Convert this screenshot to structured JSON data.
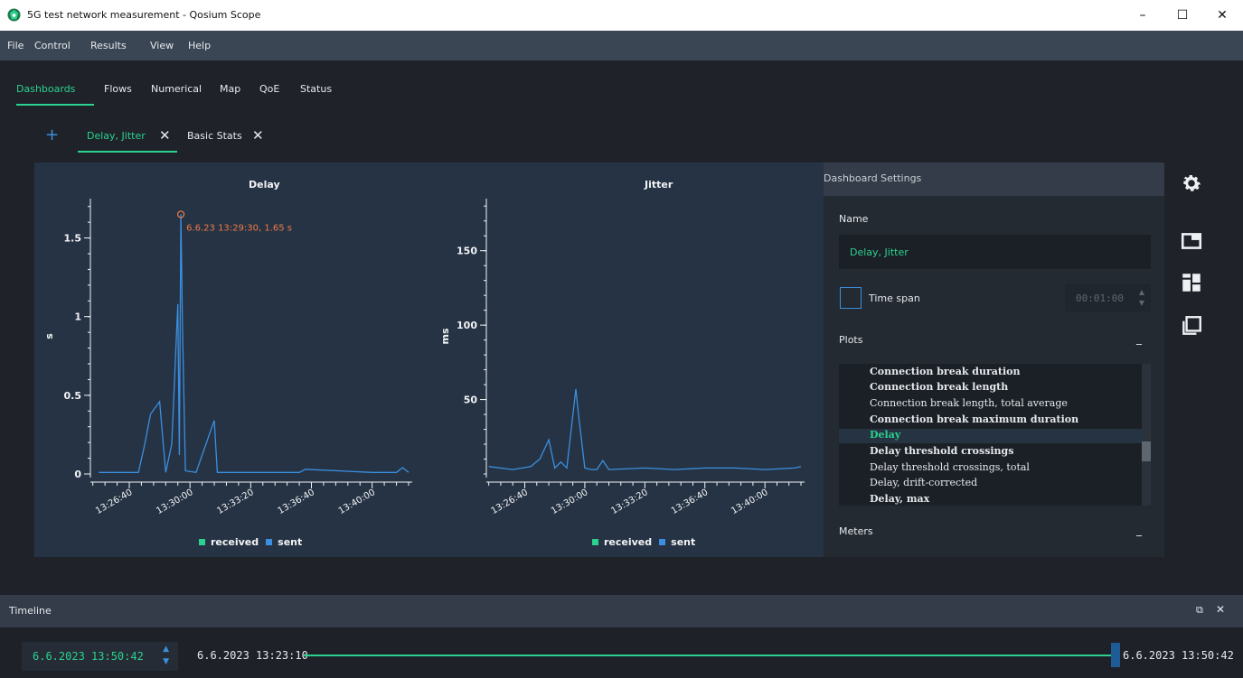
{
  "window": {
    "title": "5G test network measurement - Qosium Scope",
    "controls": {
      "minimize": "–",
      "maximize": "☐",
      "close": "✕"
    }
  },
  "menu": [
    "File",
    "Control",
    "Results",
    "View",
    "Help"
  ],
  "tabs": [
    "Dashboards",
    "Flows",
    "Numerical",
    "Map",
    "QoE",
    "Status"
  ],
  "dashboard_tabs": {
    "add": "+",
    "items": [
      "Delay, Jitter",
      "Basic Stats"
    ],
    "close_glyph": "✕"
  },
  "plots": {
    "delay": {
      "title": "Delay",
      "ylabel": "s",
      "annotation": "6.6.23 13:29:30, 1.65 s",
      "legend": [
        "received",
        "sent"
      ]
    },
    "jitter": {
      "title": "Jitter",
      "ylabel": "ms",
      "legend": [
        "received",
        "sent"
      ]
    }
  },
  "chart_data": [
    {
      "type": "line",
      "title": "Delay",
      "ylabel": "s",
      "xlabel": "",
      "ylim": [
        0,
        1.75
      ],
      "yticks": [
        0,
        0.5,
        1,
        1.5
      ],
      "xlim": [
        "13:24:32",
        "13:42:12"
      ],
      "xticks": [
        "13:26:40",
        "13:30:00",
        "13:33:20",
        "13:36:40",
        "13:40:00"
      ],
      "series": [
        {
          "name": "sent",
          "color": "#3b8fe0",
          "x": [
            "13:25:00",
            "13:27:10",
            "13:27:30",
            "13:27:50",
            "13:28:20",
            "13:28:40",
            "13:29:00",
            "13:29:20",
            "13:29:25",
            "13:29:30",
            "13:29:35",
            "13:29:45",
            "13:30:20",
            "13:31:20",
            "13:31:30",
            "13:36:00",
            "13:36:20",
            "13:40:00",
            "13:41:20",
            "13:41:40",
            "13:42:00"
          ],
          "y": [
            0.01,
            0.01,
            0.18,
            0.38,
            0.46,
            0.01,
            0.19,
            1.08,
            0.12,
            1.65,
            0.95,
            0.02,
            0.01,
            0.34,
            0.01,
            0.01,
            0.03,
            0.01,
            0.01,
            0.04,
            0.01
          ]
        },
        {
          "name": "received",
          "color": "#2bd18e",
          "x": [],
          "y": []
        }
      ],
      "annotation": {
        "x": "13:29:30",
        "y": 1.65,
        "text": "6.6.23 13:29:30, 1.65 s"
      },
      "legend_position": "bottom"
    },
    {
      "type": "line",
      "title": "Jitter",
      "ylabel": "ms",
      "xlabel": "",
      "ylim": [
        0,
        185
      ],
      "yticks": [
        50,
        100,
        150
      ],
      "xlim": [
        "13:24:32",
        "13:42:12"
      ],
      "xticks": [
        "13:26:40",
        "13:30:00",
        "13:33:20",
        "13:36:40",
        "13:40:00"
      ],
      "series": [
        {
          "name": "sent",
          "color": "#3b8fe0",
          "x": [
            "13:24:40",
            "13:26:00",
            "13:27:00",
            "13:27:30",
            "13:28:00",
            "13:28:20",
            "13:28:40",
            "13:29:00",
            "13:29:30",
            "13:29:40",
            "13:30:00",
            "13:30:20",
            "13:30:40",
            "13:31:00",
            "13:31:20",
            "13:33:20",
            "13:35:00",
            "13:36:40",
            "13:38:20",
            "13:40:00",
            "13:41:40",
            "13:42:00"
          ],
          "y": [
            5,
            3,
            5,
            10,
            23,
            4,
            8,
            4,
            57,
            38,
            4,
            3,
            3,
            9,
            3,
            4,
            3,
            4,
            4,
            3,
            4,
            5
          ]
        },
        {
          "name": "received",
          "color": "#2bd18e",
          "x": [],
          "y": []
        }
      ],
      "legend_position": "bottom"
    }
  ],
  "settings": {
    "header": "Dashboard Settings",
    "name_label": "Name",
    "name_value": "Delay, Jitter",
    "timespan_label": "Time span",
    "timespan_value": "00:01:00",
    "plots_label": "Plots",
    "meters_label": "Meters",
    "collapse_glyph": "_",
    "plot_items": [
      {
        "label": "Connection break duration",
        "bold": true,
        "selected": false
      },
      {
        "label": "Connection break length",
        "bold": true,
        "selected": false
      },
      {
        "label": "Connection break length, total average",
        "bold": false,
        "selected": false
      },
      {
        "label": "Connection break maximum duration",
        "bold": true,
        "selected": false
      },
      {
        "label": "Delay",
        "bold": true,
        "selected": true
      },
      {
        "label": "Delay threshold crossings",
        "bold": true,
        "selected": false
      },
      {
        "label": "Delay threshold crossings, total",
        "bold": false,
        "selected": false
      },
      {
        "label": "Delay, drift-corrected",
        "bold": false,
        "selected": false
      },
      {
        "label": "Delay, max",
        "bold": true,
        "selected": false
      }
    ]
  },
  "side_icons": [
    "gear-icon",
    "window-icon",
    "dashboard-layout-icon",
    "copy-icon"
  ],
  "timeline": {
    "label": "Timeline",
    "current": "6.6.2023 13:50:42",
    "start": "6.6.2023 13:23:10",
    "end": "6.6.2023 13:50:42",
    "handle_position": 1.0,
    "float_glyph": "⧉",
    "close_glyph": "✕"
  },
  "colors": {
    "accent_green": "#2bd18e",
    "accent_blue": "#3b8fe0",
    "annotation_orange": "#f07a47",
    "panel_bg": "#263344"
  }
}
